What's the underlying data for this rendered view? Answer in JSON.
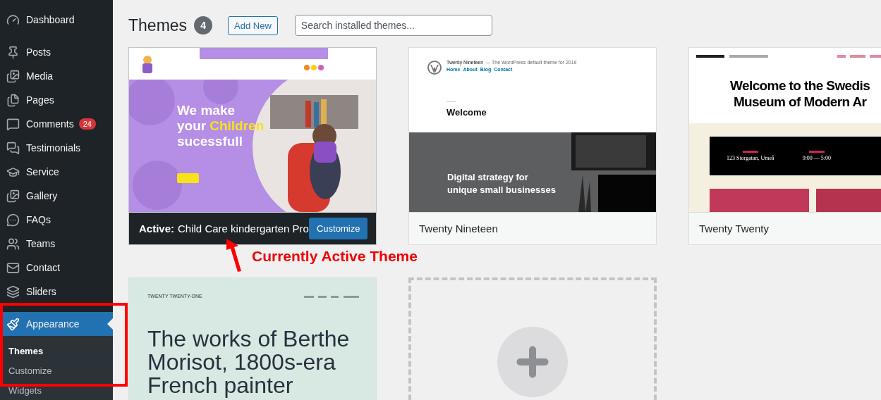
{
  "sidebar": {
    "items": [
      {
        "label": "Dashboard",
        "selected": false
      },
      {
        "label": "Posts",
        "selected": false
      },
      {
        "label": "Media",
        "selected": false
      },
      {
        "label": "Pages",
        "selected": false
      },
      {
        "label": "Comments",
        "selected": false,
        "badge": "24"
      },
      {
        "label": "Testimonials",
        "selected": false
      },
      {
        "label": "Service",
        "selected": false
      },
      {
        "label": "Gallery",
        "selected": false
      },
      {
        "label": "FAQs",
        "selected": false
      },
      {
        "label": "Teams",
        "selected": false
      },
      {
        "label": "Contact",
        "selected": false
      },
      {
        "label": "Sliders",
        "selected": false
      },
      {
        "label": "Appearance",
        "selected": true,
        "children": [
          {
            "label": "Themes",
            "selected": true
          },
          {
            "label": "Customize",
            "selected": false
          },
          {
            "label": "Widgets",
            "selected": false
          }
        ]
      }
    ]
  },
  "header": {
    "title": "Themes",
    "count": "4",
    "add_new": "Add New",
    "search": {
      "placeholder": "Search installed themes..."
    }
  },
  "themes": [
    {
      "kind": "child-care",
      "active": true,
      "active_label": "Active:",
      "name": "Child Care kindergarten Pro",
      "action": "Customize",
      "preview": {
        "line_1": "We make",
        "line_2": "your",
        "line_2_accent": "Children",
        "line_3": "sucessfull"
      }
    },
    {
      "kind": "nineteen",
      "active": false,
      "name": "Twenty Nineteen",
      "preview": {
        "site_title": "Twenty Nineteen",
        "tagline": "— The WordPress default theme for 2019",
        "nav": [
          "Home",
          "About",
          "Blog",
          "Contact"
        ],
        "heading": "Welcome",
        "banner": [
          "Digital strategy for",
          "unique small businesses"
        ]
      }
    },
    {
      "kind": "twenty",
      "active": false,
      "name": "Twenty Twenty",
      "preview": {
        "headline": [
          "Welcome to the Swedis",
          "Museum of Modern Ar"
        ],
        "info": [
          {
            "value": "123 Storgatan, Umeå"
          },
          {
            "value": "9:00 — 5:00"
          }
        ]
      }
    },
    {
      "kind": "twenty-one",
      "preview": {
        "site_title": "TWENTY TWENTY-ONE",
        "headline": [
          "The works of Berthe",
          "Morisot, 1800s-era",
          "French painter"
        ]
      }
    },
    {
      "kind": "add-new"
    }
  ],
  "annotation": {
    "text": "Currently Active Theme"
  }
}
